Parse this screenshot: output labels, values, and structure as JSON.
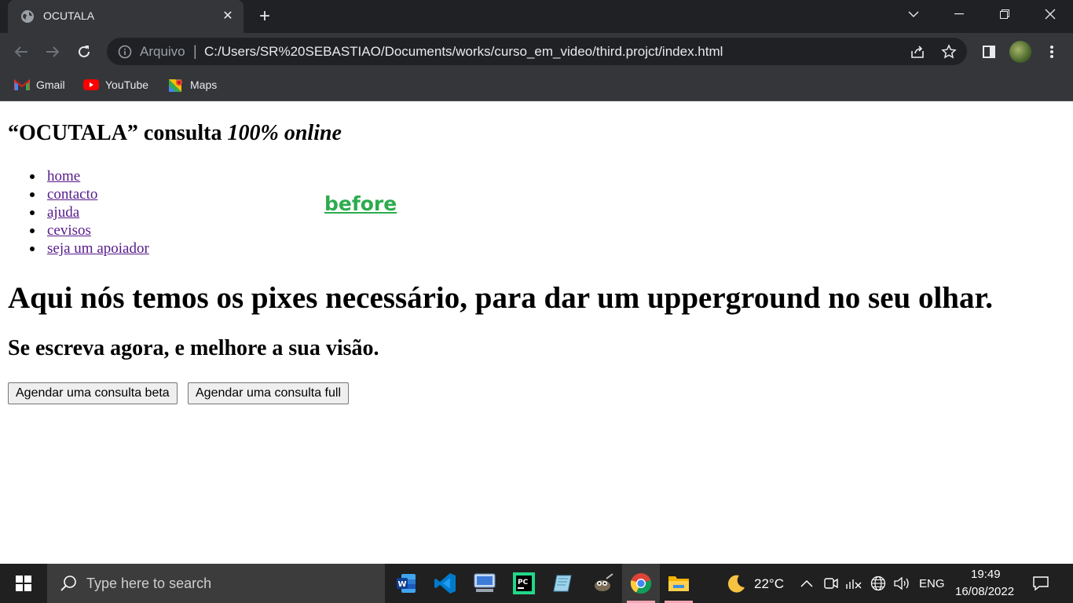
{
  "browser": {
    "tab": {
      "title": "OCUTALA"
    },
    "address": {
      "scheme_label": "Arquivo",
      "separator": "|",
      "url": "C:/Users/SR%20SEBASTIAO/Documents/works/curso_em_video/third.projct/index.html"
    },
    "bookmarks": [
      {
        "label": "Gmail",
        "icon": "gmail-icon"
      },
      {
        "label": "YouTube",
        "icon": "youtube-icon"
      },
      {
        "label": "Maps",
        "icon": "maps-icon"
      }
    ]
  },
  "page": {
    "brand_heading": {
      "quoted": "“OCUTALA” consulta",
      "emphasis": "100% online"
    },
    "nav": [
      {
        "label": "home"
      },
      {
        "label": "contacto"
      },
      {
        "label": "ajuda"
      },
      {
        "label": "cevisos"
      },
      {
        "label": "seja um apoiador"
      }
    ],
    "before_text": "before",
    "main_heading": "Aqui nós temos os pixes necessário, para dar um upperground no seu olhar.",
    "sub_heading": "Se escreva agora, e melhore a sua visão.",
    "buttons": {
      "beta": "Agendar uma consulta beta",
      "full": "Agendar uma consulta full"
    }
  },
  "taskbar": {
    "search_placeholder": "Type here to search",
    "apps": [
      "word-icon",
      "vscode-icon",
      "remote-desktop-icon",
      "pycharm-icon",
      "notes-icon",
      "gimp-icon",
      "chrome-icon",
      "file-explorer-icon"
    ],
    "weather": {
      "temp": "22°C",
      "icon": "moon-icon"
    },
    "language": "ENG",
    "time": "19:49",
    "date": "16/08/2022"
  },
  "colors": {
    "link_visited": "#551a8b",
    "before_green": "#2eab4e",
    "chrome_dark": "#202124",
    "chrome_mid": "#35363a",
    "taskbar": "#202020"
  }
}
